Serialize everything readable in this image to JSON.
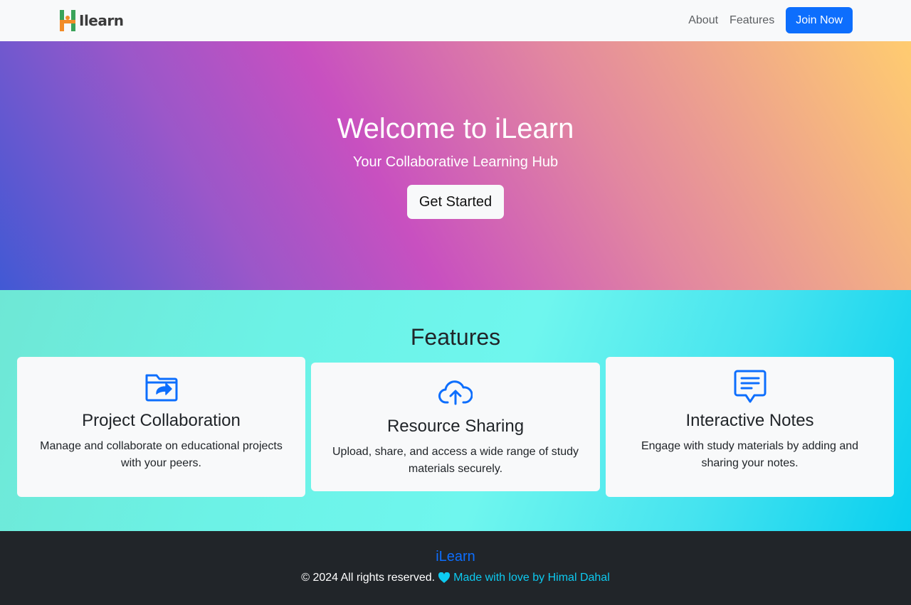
{
  "navbar": {
    "brand_text": "Ilearn",
    "links": [
      {
        "label": "About"
      },
      {
        "label": "Features"
      }
    ],
    "join_label": "Join Now"
  },
  "hero": {
    "title": "Welcome to iLearn",
    "subtitle": "Your Collaborative Learning Hub",
    "cta_label": "Get Started"
  },
  "features": {
    "title": "Features",
    "cards": [
      {
        "icon": "folder-share-icon",
        "title": "Project Collaboration",
        "text": "Manage and collaborate on educational projects with your peers."
      },
      {
        "icon": "cloud-upload-icon",
        "title": "Resource Sharing",
        "text": "Upload, share, and access a wide range of study materials securely."
      },
      {
        "icon": "chat-text-icon",
        "title": "Interactive Notes",
        "text": "Engage with study materials by adding and sharing your notes."
      }
    ]
  },
  "footer": {
    "brand": "iLearn",
    "copyright": "© 2024 All rights reserved.",
    "made_by": "Made with love by Himal Dahal"
  },
  "colors": {
    "primary": "#0d6efd",
    "info": "#0dcaf0",
    "dark": "#212529",
    "light": "#f8f9fa"
  }
}
